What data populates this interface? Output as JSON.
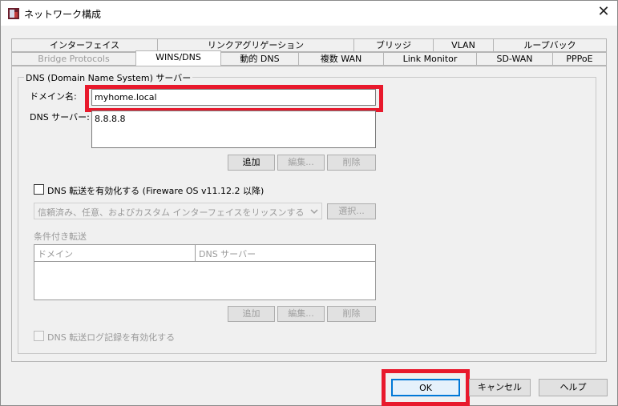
{
  "window": {
    "title": "ネットワーク構成",
    "close_glyph": "✕"
  },
  "tabs_row1": [
    "インターフェイス",
    "リンクアグリゲーション",
    "ブリッジ",
    "VLAN",
    "ループバック"
  ],
  "tabs_row2": [
    "Bridge Protocols",
    "WINS/DNS",
    "動的 DNS",
    "複数 WAN",
    "Link Monitor",
    "SD-WAN",
    "PPPoE"
  ],
  "dns_group": {
    "legend": "DNS (Domain Name System) サーバー",
    "domain_label": "ドメイン名:",
    "domain_value": "myhome.local",
    "server_label": "DNS サーバー:",
    "servers": [
      "8.8.8.8"
    ],
    "buttons": {
      "add": "追加",
      "edit": "編集...",
      "delete": "削除"
    },
    "forwarding_checkbox": "DNS 転送を有効化する (Fireware OS v11.12.2 以降)",
    "listen_select": "信頼済み、任意、およびカスタム インターフェイスをリッスンする",
    "select_button": "選択...",
    "conditional_label": "条件付き転送",
    "columns": [
      "ドメイン",
      "DNS サーバー"
    ],
    "buttons2": {
      "add": "追加",
      "edit": "編集...",
      "delete": "削除"
    },
    "log_checkbox": "DNS 転送ログ記録を有効化する"
  },
  "footer": {
    "ok": "OK",
    "cancel": "キャンセル",
    "help": "ヘルプ"
  },
  "colors": {
    "highlight": "#e8192c"
  }
}
